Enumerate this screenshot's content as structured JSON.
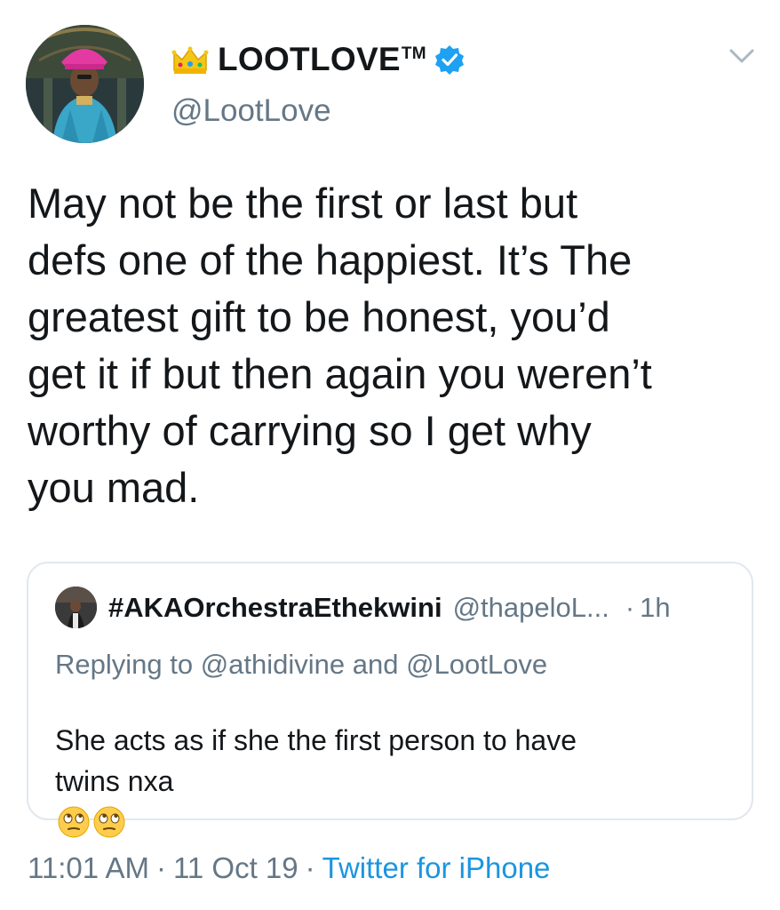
{
  "author": {
    "display_name": "LOOTLOVE",
    "trademark": "TM",
    "handle": "@LootLove",
    "verified": true,
    "crown_icon": "crown-emoji",
    "verified_color": "#1da1f2"
  },
  "tweet": {
    "lines": [
      "May not be the first or last but",
      "defs one of the happiest. It’s The",
      "greatest gift to be honest, you’d",
      "get it if but then again you weren’t",
      "worthy of carrying so I get why",
      "you mad."
    ]
  },
  "quote": {
    "name": "#AKAOrchestraEthekwini",
    "handle": "@thapeloL...",
    "dot": "·",
    "time": "1h",
    "replying_to": "Replying to @athidivine and @LootLove",
    "text_line1": "She acts as if she the first person to have",
    "text_line2": "twins nxa",
    "emojis": [
      "face-with-rolling-eyes",
      "face-with-rolling-eyes"
    ]
  },
  "footer": {
    "time": "11:01 AM",
    "sep1": "·",
    "date": "11 Oct 19",
    "sep2": "·",
    "source": "Twitter for iPhone"
  },
  "colors": {
    "text": "#14171a",
    "secondary": "#657786",
    "link": "#1b95e0",
    "border": "#e1e8ed"
  }
}
